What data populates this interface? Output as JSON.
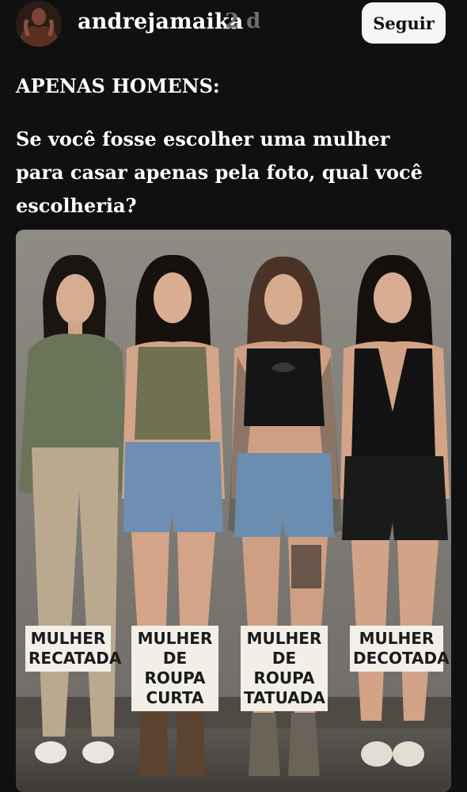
{
  "post": {
    "username": "andrejamaika",
    "timestamp": "2 d",
    "follow_label": "Seguir",
    "title": "APENAS HOMENS:",
    "question": "Se você fosse escolher uma mulher para casar apenas pela foto, qual você escolheria?",
    "image": {
      "labels": [
        "MULHER\nRECATADA",
        "MULHER\nDE ROUPA\nCURTA",
        "MULHER\nDE ROUPA\nTATUADA",
        "MULHER\nDECOTADA"
      ]
    }
  },
  "colors": {
    "background": "#101010",
    "button_bg": "#f5f5f5",
    "muted_text": "#6f6f6f"
  }
}
